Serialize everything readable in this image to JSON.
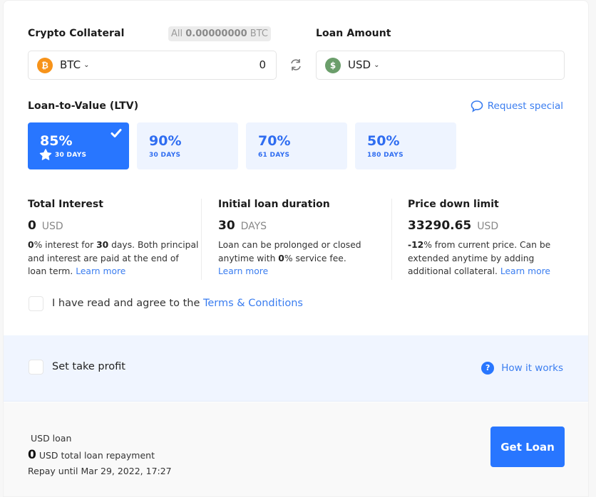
{
  "collateral": {
    "label": "Crypto Collateral",
    "all_prefix": "All",
    "all_amount": "0.00000000",
    "all_unit": "BTC",
    "currency": "BTC",
    "currency_icon": "bitcoin-icon",
    "amount": "0"
  },
  "swap_icon": "swap-icon",
  "loan": {
    "label": "Loan Amount",
    "currency": "USD",
    "currency_icon": "dollar-icon",
    "amount": ""
  },
  "ltv": {
    "label": "Loan-to-Value (LTV)",
    "request_special": "Request special",
    "options": [
      {
        "pct": "85%",
        "days": "30 DAYS",
        "selected": true,
        "featured": true
      },
      {
        "pct": "90%",
        "days": "30 DAYS",
        "selected": false
      },
      {
        "pct": "70%",
        "days": "61 DAYS",
        "selected": false
      },
      {
        "pct": "50%",
        "days": "180 DAYS",
        "selected": false
      }
    ]
  },
  "info": {
    "interest": {
      "title": "Total Interest",
      "value": "0",
      "unit": "USD",
      "pct": "0",
      "text1": "% interest for ",
      "days": "30",
      "text2": " days. Both principal and interest are paid at the end of loan term. ",
      "link": "Learn more"
    },
    "duration": {
      "title": "Initial loan duration",
      "value": "30",
      "unit": "DAYS",
      "text1": "Loan can be prolonged or closed anytime with ",
      "fee": "0",
      "text2": "% service fee. ",
      "link": "Learn more"
    },
    "price_limit": {
      "title": "Price down limit",
      "value": "33290.65",
      "unit": "USD",
      "pct": "-12",
      "text": "% from current price. Can be extended anytime by adding additional collateral. ",
      "link": "Learn more"
    }
  },
  "terms": {
    "checked": false,
    "text": "I have read and agree to the ",
    "link": "Terms & Conditions"
  },
  "take_profit": {
    "checked": false,
    "label": "Set take profit",
    "how_it_works": "How it works"
  },
  "summary": {
    "title": "USD loan",
    "total": "0",
    "total_text": " USD total loan repayment",
    "repay_until": "Repay until Mar 29, 2022, 17:27",
    "button": "Get Loan"
  },
  "colors": {
    "accent": "#2876ff",
    "link": "#3a7df0",
    "btc": "#f7931a",
    "usd": "#6b9e6b",
    "ltv_bg": "#eef4ff"
  }
}
